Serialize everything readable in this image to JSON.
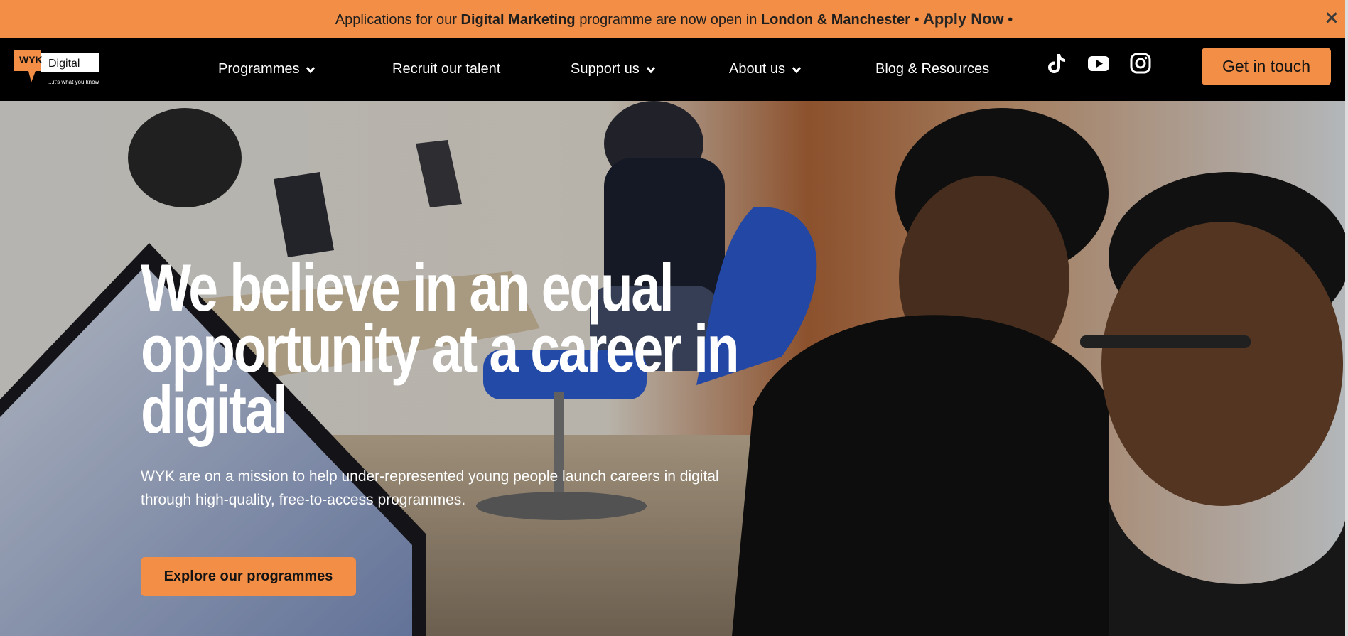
{
  "banner": {
    "pre": "Applications for our ",
    "programme": "Digital Marketing",
    "mid": " programme are now open in ",
    "cities": "London & Manchester",
    "sep1": " • ",
    "apply": "Apply Now",
    "sep2": " •",
    "close_icon": "close-icon",
    "color": "#f28e46"
  },
  "header": {
    "logo": {
      "brand": "WYK",
      "name": "Digital",
      "tagline": "...it's what you know"
    },
    "nav": [
      {
        "label": "Programmes",
        "dropdown": true
      },
      {
        "label": "Recruit our talent",
        "dropdown": false
      },
      {
        "label": "Support us",
        "dropdown": true
      },
      {
        "label": "About us",
        "dropdown": true
      },
      {
        "label": "Blog & Resources",
        "dropdown": false
      }
    ],
    "social": [
      "tiktok-icon",
      "youtube-icon",
      "instagram-icon"
    ],
    "cta": "Get in touch"
  },
  "hero": {
    "title_lines": [
      "We believe in an equal",
      "opportunity at a career in",
      "digital"
    ],
    "subtitle_lines": [
      "WYK are on a mission to help under-represented young people launch careers in digital",
      "through high-quality, free-to-access programmes."
    ],
    "button": "Explore our programmes"
  },
  "theme": {
    "accent": "#f28e46",
    "header_bg": "#000000",
    "text_light": "#ffffff"
  }
}
